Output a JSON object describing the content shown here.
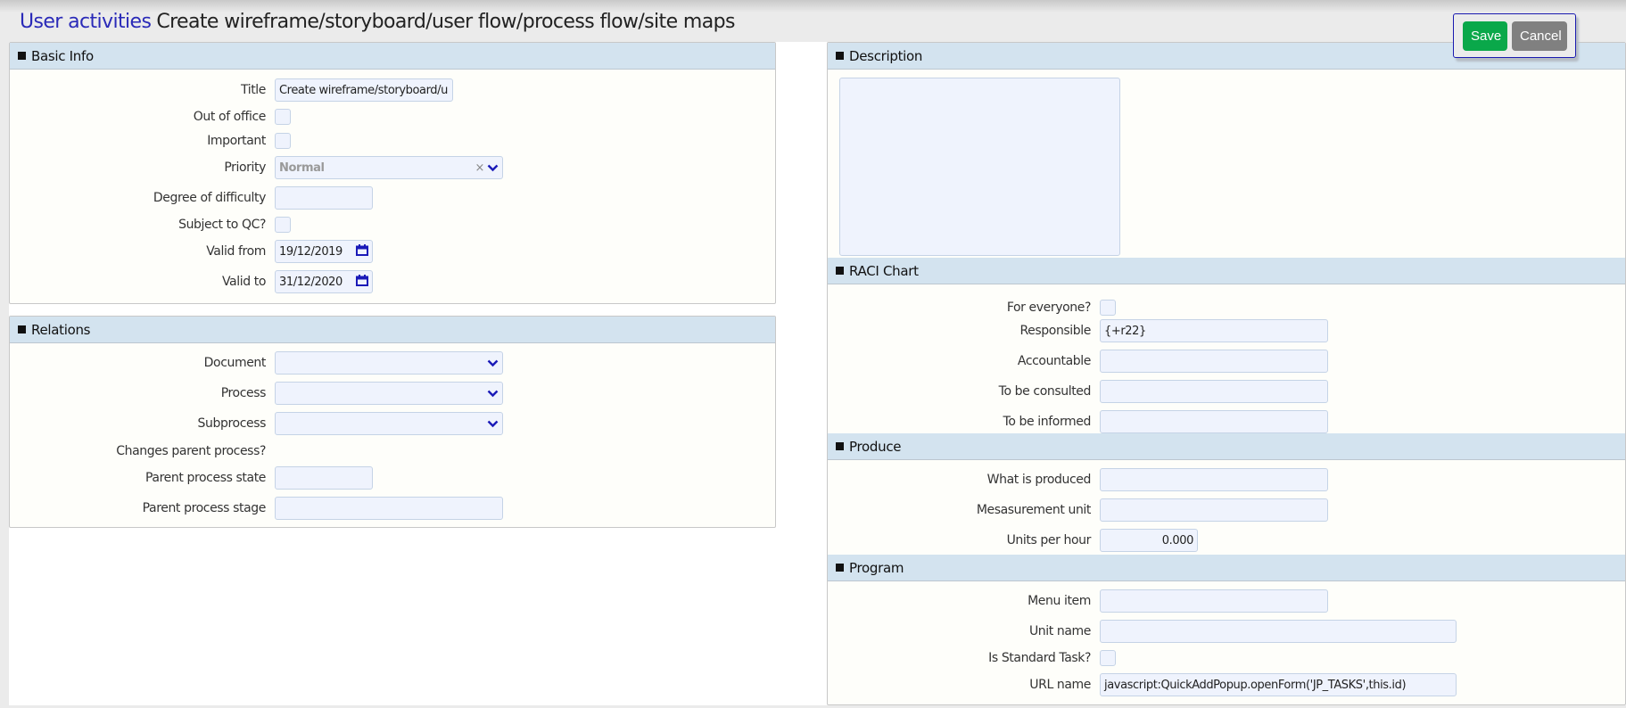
{
  "header": {
    "breadcrumb": "User activities",
    "title": "Create wireframe/storyboard/user flow/process flow/site maps"
  },
  "actions": {
    "save_label": "Save",
    "cancel_label": "Cancel"
  },
  "colors": {
    "save": "#0aa84a",
    "cancel": "#808080",
    "link": "#2a2ab8",
    "section_header": "#d3e3ef"
  },
  "basic_info": {
    "heading": "Basic Info",
    "title_label": "Title",
    "title_value": "Create wireframe/storyboard/u",
    "out_of_office_label": "Out of office",
    "important_label": "Important",
    "priority_label": "Priority",
    "priority_value": "Normal",
    "difficulty_label": "Degree of difficulty",
    "difficulty_value": "",
    "qc_label": "Subject to QC?",
    "valid_from_label": "Valid from",
    "valid_from_value": "19/12/2019",
    "valid_to_label": "Valid to",
    "valid_to_value": "31/12/2020"
  },
  "relations": {
    "heading": "Relations",
    "document_label": "Document",
    "process_label": "Process",
    "subprocess_label": "Subprocess",
    "changes_parent_label": "Changes parent process?",
    "parent_state_label": "Parent process state",
    "parent_stage_label": "Parent process stage"
  },
  "description": {
    "heading": "Description",
    "value": ""
  },
  "raci": {
    "heading": "RACI Chart",
    "everyone_label": "For everyone?",
    "responsible_label": "Responsible",
    "responsible_value": "{+r22}",
    "accountable_label": "Accountable",
    "consulted_label": "To be consulted",
    "informed_label": "To be informed"
  },
  "produce": {
    "heading": "Produce",
    "what_label": "What is produced",
    "unit_label": "Mesasurement unit",
    "uph_label": "Units per hour",
    "uph_value": "0.000"
  },
  "program": {
    "heading": "Program",
    "menu_label": "Menu item",
    "unit_name_label": "Unit name",
    "standard_label": "Is Standard Task?",
    "url_label": "URL name",
    "url_value": "javascript:QuickAddPopup.openForm('JP_TASKS',this.id)"
  }
}
